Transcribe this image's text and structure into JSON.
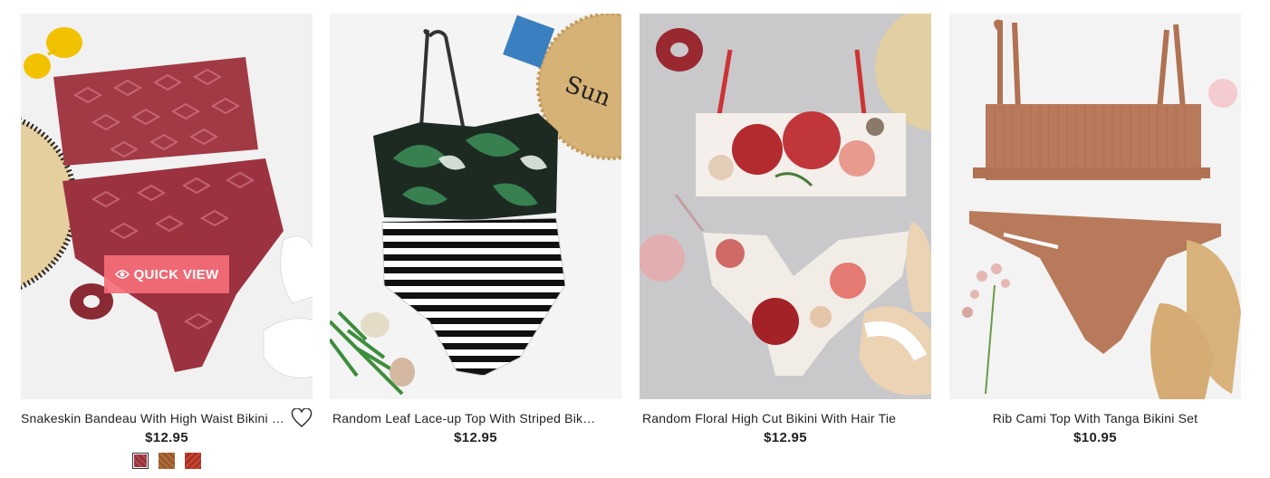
{
  "products": [
    {
      "title": "Snakeskin Bandeau With High Waist Bikini Set",
      "price": "$12.95",
      "quick_view_label": "QUICK VIEW",
      "image_bg": "#f1f1f1",
      "swatches": [
        "#9a2f3a",
        "#b06a36",
        "#c9412f"
      ]
    },
    {
      "title": "Random Leaf Lace-up Top With Striped Bikini Set",
      "price": "$12.95",
      "image_bg": "#f4f4f4"
    },
    {
      "title": "Random Floral High Cut Bikini With Hair Tie",
      "price": "$12.95",
      "image_bg": "#c9c9cb"
    },
    {
      "title": "Rib Cami Top With Tanga Bikini Set",
      "price": "$10.95",
      "image_bg": "#f3f3f3"
    }
  ],
  "icons": {
    "wishlist": "heart-outline-icon",
    "quick_view": "eye-icon"
  },
  "colors": {
    "quick_view_bg": "#f56e78",
    "price": "#222222"
  }
}
